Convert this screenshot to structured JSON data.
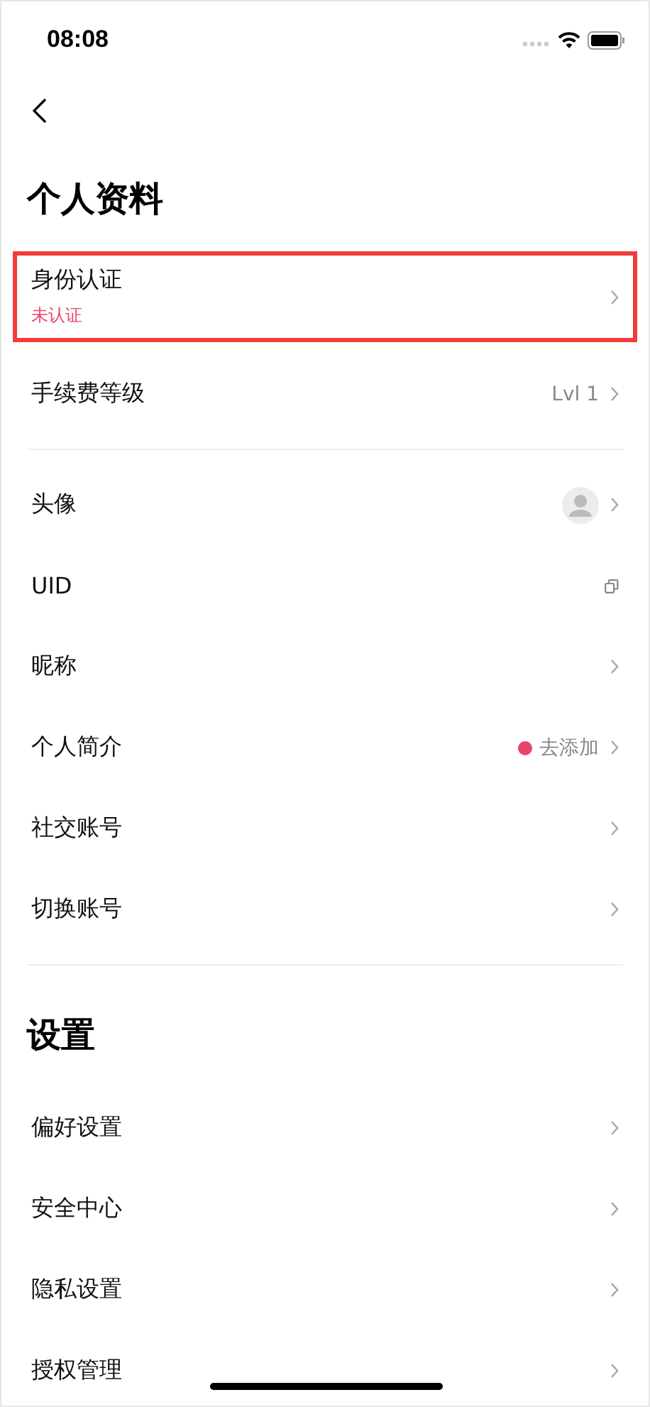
{
  "status_bar": {
    "time": "08:08"
  },
  "sections": [
    {
      "title": "个人资料",
      "groups": [
        [
          {
            "label": "身份认证",
            "sublabel": "未认证",
            "kind": "link",
            "highlighted": true
          },
          {
            "label": "手续费等级",
            "value": "Lvl 1",
            "kind": "value",
            "highlighted": false
          }
        ],
        [
          {
            "label": "头像",
            "kind": "avatar",
            "highlighted": false
          },
          {
            "label": "UID",
            "kind": "copy",
            "highlighted": false
          },
          {
            "label": "昵称",
            "kind": "link",
            "highlighted": false
          },
          {
            "label": "个人简介",
            "value": "去添加",
            "kind": "dot-value",
            "color": "#e8456b",
            "highlighted": false
          },
          {
            "label": "社交账号",
            "kind": "link",
            "highlighted": false
          },
          {
            "label": "切换账号",
            "kind": "link",
            "highlighted": false
          }
        ]
      ]
    },
    {
      "title": "设置",
      "groups": [
        [
          {
            "label": "偏好设置",
            "kind": "link",
            "highlighted": false
          },
          {
            "label": "安全中心",
            "kind": "link",
            "highlighted": false
          },
          {
            "label": "隐私设置",
            "kind": "link",
            "highlighted": false
          },
          {
            "label": "授权管理",
            "kind": "link",
            "highlighted": false
          }
        ]
      ]
    }
  ]
}
